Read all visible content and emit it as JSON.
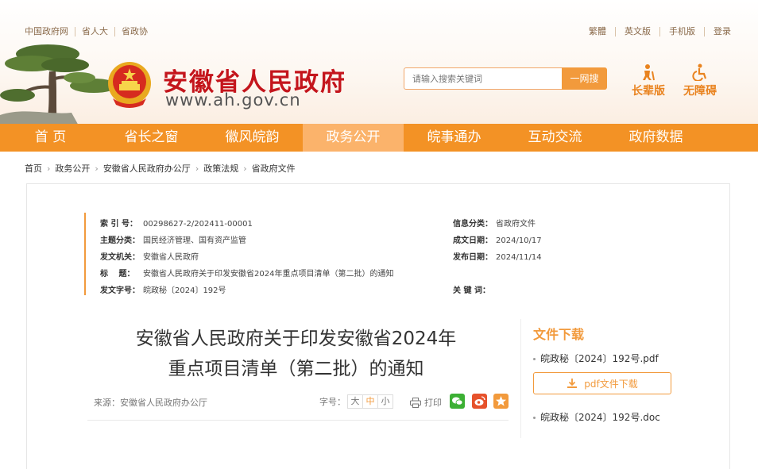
{
  "top_links_left": [
    "中国政府网",
    "省人大",
    "省政协"
  ],
  "top_links_right": [
    "繁體",
    "英文版",
    "手机版",
    "登录"
  ],
  "site": {
    "title": "安徽省人民政府",
    "url": "www.ah.gov.cn"
  },
  "search": {
    "placeholder": "请输入搜索关键词",
    "button": "一网搜"
  },
  "tools": {
    "elderly": "长辈版",
    "accessible": "无障碍"
  },
  "nav": [
    "首 页",
    "省长之窗",
    "徽风皖韵",
    "政务公开",
    "皖事通办",
    "互动交流",
    "政府数据"
  ],
  "nav_active_index": 3,
  "breadcrumb": [
    "首页",
    "政务公开",
    "安徽省人民政府办公厅",
    "政策法规",
    "省政府文件"
  ],
  "meta": {
    "index_label": "索 引 号：",
    "index_value": "00298627-2/202411-00001",
    "topic_label": "主题分类：",
    "topic_value": "国民经济管理、国有资产监管",
    "issuer_label": "发文机关：",
    "issuer_value": "安徽省人民政府",
    "title_label": "标　 题：",
    "title_value": "安徽省人民政府关于印发安徽省2024年重点项目清单（第二批）的通知",
    "docno_label": "发文字号：",
    "docno_value": "皖政秘〔2024〕192号",
    "info_label": "信息分类：",
    "info_value": "省政府文件",
    "written_label": "成文日期：",
    "written_value": "2024/10/17",
    "published_label": "发布日期：",
    "published_value": "2024/11/14",
    "keywords_label": "关 键 词：",
    "keywords_value": ""
  },
  "doc": {
    "title_line1": "安徽省人民政府关于印发安徽省2024年",
    "title_line2": "重点项目清单（第二批）的通知",
    "source": "来源：安徽省人民政府办公厅",
    "font_label": "字号：",
    "font_sizes": [
      "大",
      "中",
      "小"
    ],
    "print": "打印"
  },
  "download": {
    "title": "文件下载",
    "pdf_file": "皖政秘〔2024〕192号.pdf",
    "pdf_button": "pdf文件下载",
    "doc_file": "皖政秘〔2024〕192号.doc"
  },
  "colors": {
    "accent": "#f39225",
    "title_red": "#c4151c",
    "wechat": "#3cb034",
    "weibo": "#e6522c",
    "favorite": "#f29a3c"
  }
}
